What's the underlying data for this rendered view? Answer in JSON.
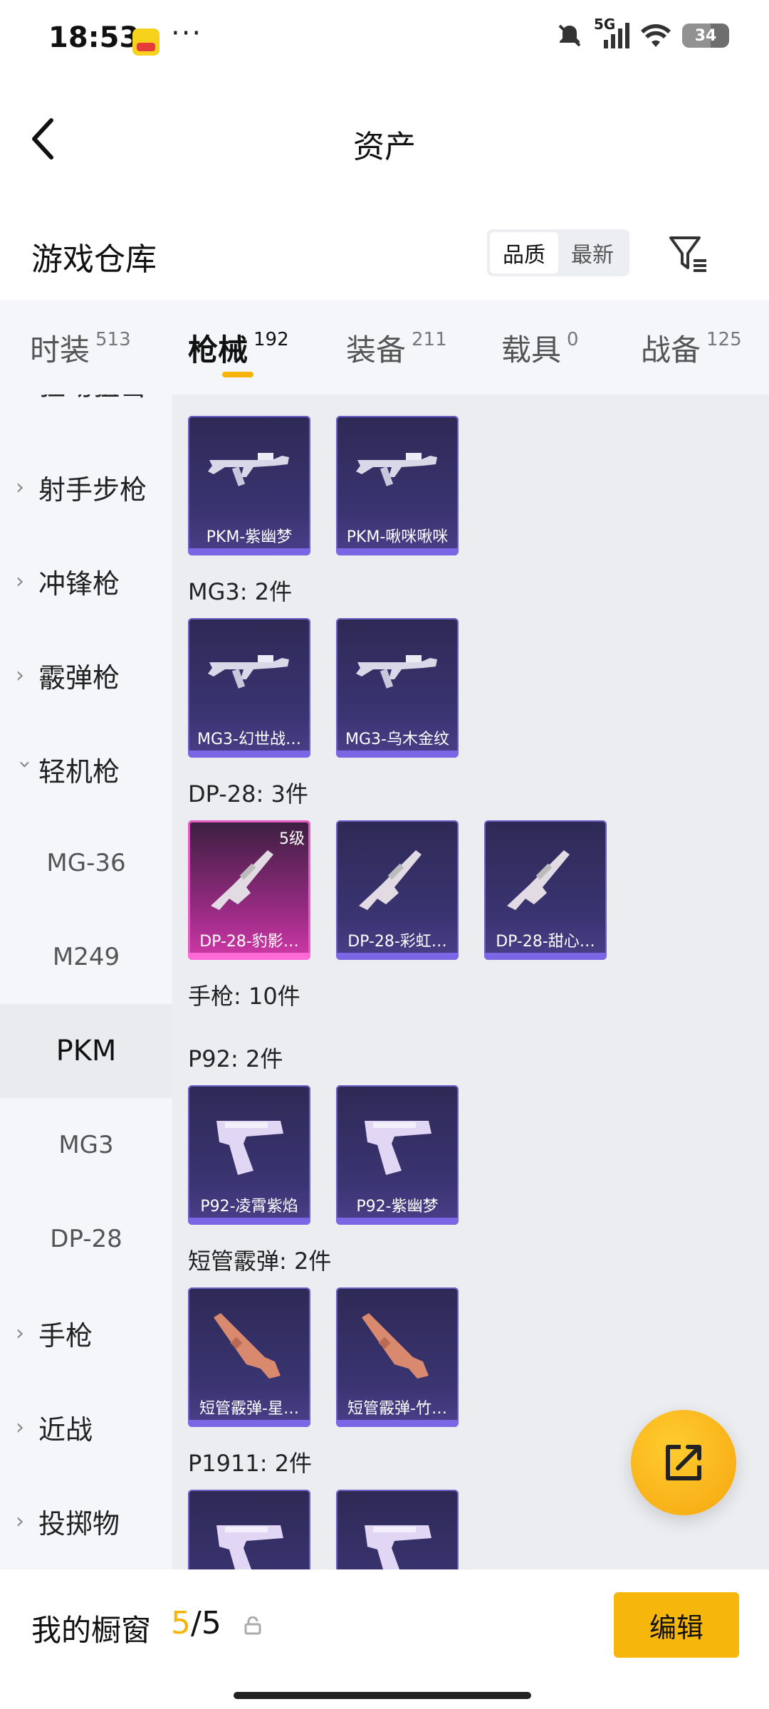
{
  "status_bar": {
    "time": "18:53",
    "more": "···",
    "network": "5G",
    "battery": "34"
  },
  "header": {
    "title": "资产"
  },
  "warehouse": {
    "title": "游戏仓库",
    "sort_options": [
      "品质",
      "最新"
    ],
    "sort_selected": "品质"
  },
  "tabs": [
    {
      "label": "时装",
      "count": "513"
    },
    {
      "label": "枪械",
      "count": "192"
    },
    {
      "label": "装备",
      "count": "211"
    },
    {
      "label": "载具",
      "count": "0"
    },
    {
      "label": "战备",
      "count": "125"
    }
  ],
  "sidenav": {
    "partial_top": "狂动狙击",
    "items": [
      {
        "label": "射手步枪"
      },
      {
        "label": "冲锋枪"
      },
      {
        "label": "霰弹枪"
      },
      {
        "label": "轻机枪"
      }
    ],
    "subitems": [
      "MG-36",
      "M249",
      "PKM",
      "MG3",
      "DP-28"
    ],
    "selected_sub": "PKM",
    "items_after": [
      {
        "label": "手枪"
      },
      {
        "label": "近战"
      },
      {
        "label": "投掷物"
      }
    ]
  },
  "content": {
    "groups": [
      {
        "title": "",
        "cards": [
          {
            "name": "PKM-紫幽梦",
            "rarity": "purple",
            "weapon": "mg"
          },
          {
            "name": "PKM-啾咪啾咪",
            "rarity": "purple",
            "weapon": "mg"
          }
        ]
      },
      {
        "title": "MG3: 2件",
        "cards": [
          {
            "name": "MG3-幻世战…",
            "rarity": "purple",
            "weapon": "mg"
          },
          {
            "name": "MG3-乌木金纹",
            "rarity": "purple",
            "weapon": "mg"
          }
        ]
      },
      {
        "title": "DP-28: 3件",
        "cards": [
          {
            "name": "DP-28-豹影…",
            "rarity": "gold",
            "level": "5级",
            "weapon": "rifle"
          },
          {
            "name": "DP-28-彩虹…",
            "rarity": "purple",
            "weapon": "rifle"
          },
          {
            "name": "DP-28-甜心…",
            "rarity": "purple",
            "weapon": "rifle"
          }
        ]
      },
      {
        "title": "手枪: 10件",
        "cards": []
      },
      {
        "title": "P92: 2件",
        "cards": [
          {
            "name": "P92-凌霄紫焰",
            "rarity": "purple",
            "weapon": "pistol"
          },
          {
            "name": "P92-紫幽梦",
            "rarity": "purple",
            "weapon": "pistol"
          }
        ]
      },
      {
        "title": "短管霰弹: 2件",
        "cards": [
          {
            "name": "短管霰弹-星…",
            "rarity": "purple",
            "weapon": "shotgun"
          },
          {
            "name": "短管霰弹-竹…",
            "rarity": "purple",
            "weapon": "shotgun"
          }
        ]
      },
      {
        "title": "P1911: 2件",
        "cards": [
          {
            "name": "",
            "rarity": "purple",
            "weapon": "pistol"
          },
          {
            "name": "",
            "rarity": "purple",
            "weapon": "pistol"
          }
        ]
      }
    ]
  },
  "bottom_bar": {
    "showcase_label": "我的橱窗",
    "current": "5",
    "separator": "/",
    "total": "5",
    "edit_label": "编辑"
  },
  "colors": {
    "accent": "#f5b407",
    "card_purple": "#3a3472",
    "card_gold": "#d13aa8"
  }
}
